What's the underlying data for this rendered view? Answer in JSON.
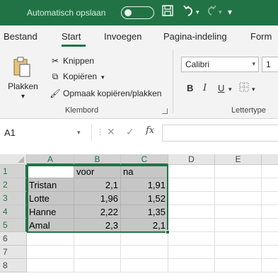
{
  "titlebar": {
    "autosave_label": "Automatisch opslaan",
    "autosave_state": "off",
    "icons": [
      "save-icon",
      "undo-icon",
      "redo-icon",
      "customize-qat-icon"
    ]
  },
  "tabs": [
    {
      "label": "Bestand",
      "active": false
    },
    {
      "label": "Start",
      "active": true
    },
    {
      "label": "Invoegen",
      "active": false
    },
    {
      "label": "Pagina-indeling",
      "active": false
    },
    {
      "label": "Form",
      "active": false
    }
  ],
  "ribbon": {
    "clipboard": {
      "paste_label": "Plakken",
      "cut_label": "Knippen",
      "copy_label": "Kopiëren",
      "format_painter_label": "Opmaak kopiëren/plakken",
      "group_label": "Klembord"
    },
    "font": {
      "font_name": "Calibri",
      "font_size": "1",
      "group_label": "Lettertype",
      "bold": "B",
      "italic": "I",
      "underline": "U"
    }
  },
  "formula_bar": {
    "name_box": "A1",
    "fx_label": "fx",
    "value": ""
  },
  "sheet": {
    "columns": [
      "A",
      "B",
      "C",
      "D",
      "E"
    ],
    "rows": [
      "1",
      "2",
      "3",
      "4",
      "5",
      "6",
      "7",
      "8"
    ],
    "cells": [
      [
        "",
        "voor",
        "na",
        "",
        ""
      ],
      [
        "Tristan",
        "2,1",
        "1,91",
        "",
        ""
      ],
      [
        "Lotte",
        "1,96",
        "1,52",
        "",
        ""
      ],
      [
        "Hanne",
        "2,22",
        "1,35",
        "",
        ""
      ],
      [
        "Amal",
        "2,3",
        "2,1",
        "",
        ""
      ],
      [
        "",
        "",
        "",
        "",
        ""
      ],
      [
        "",
        "",
        "",
        "",
        ""
      ],
      [
        "",
        "",
        "",
        "",
        ""
      ]
    ],
    "selection": "A1:C5",
    "active_cell": "A1",
    "colors": {
      "accent": "#217346",
      "selection_fill": "#c6c6c6"
    }
  }
}
